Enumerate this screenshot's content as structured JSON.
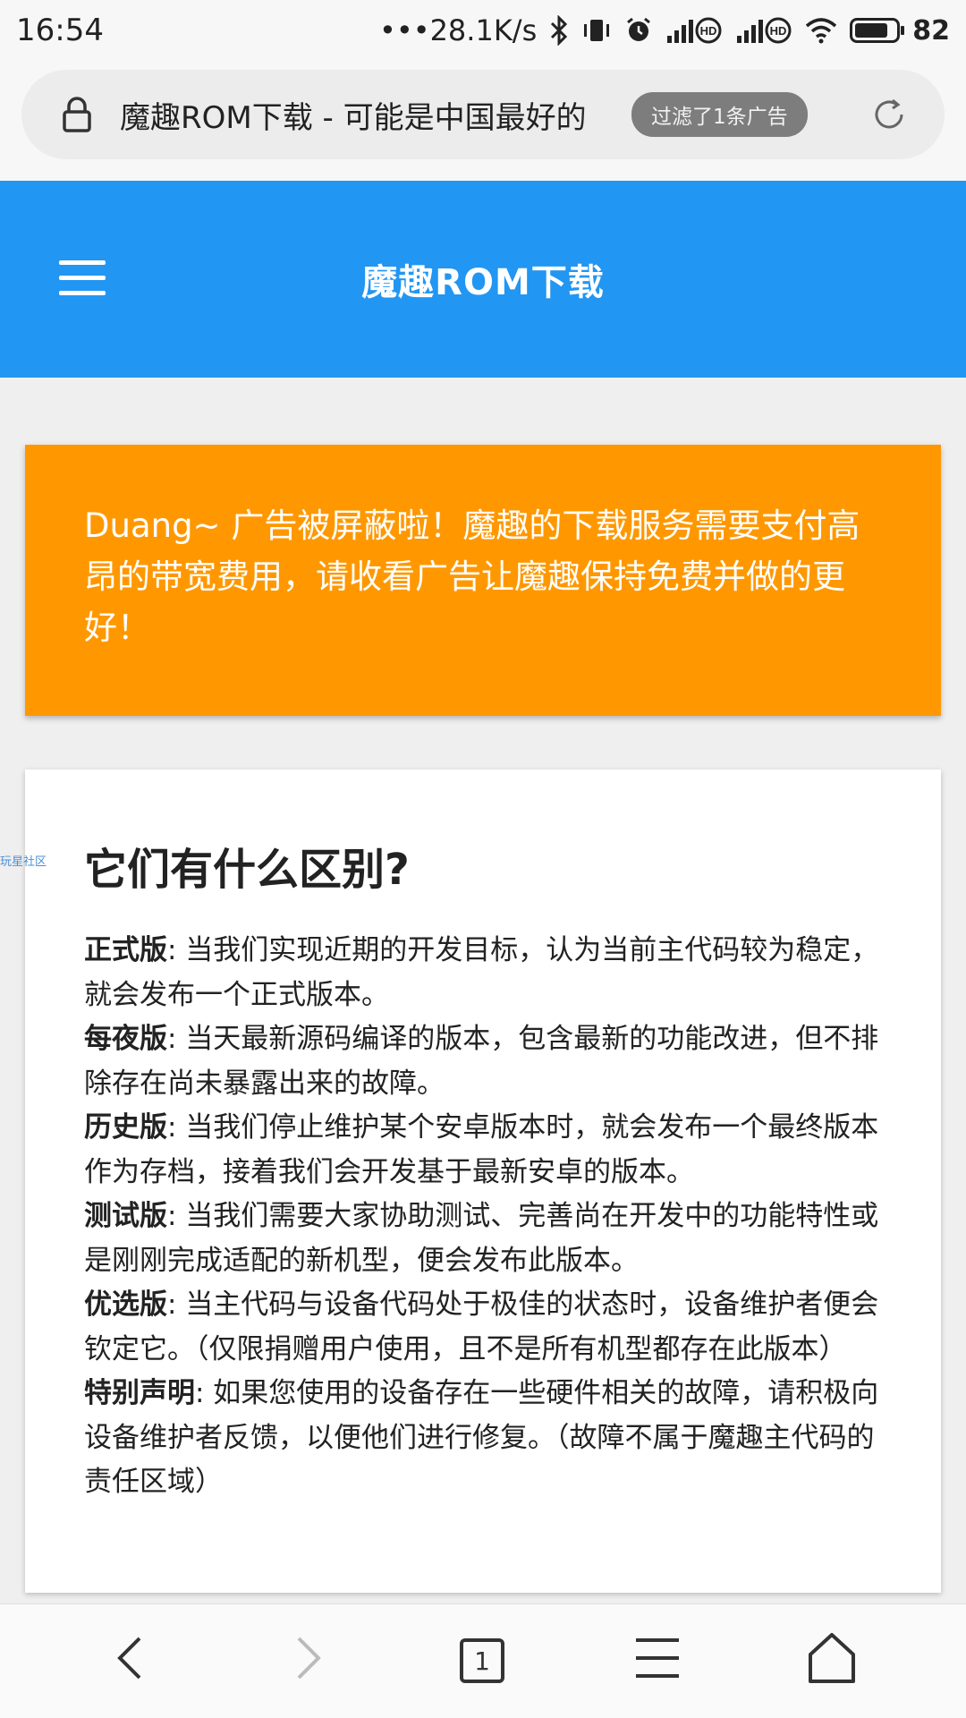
{
  "status_bar": {
    "time": "16:54",
    "net_speed": "•••28.1K/s",
    "battery": "82",
    "battery_level": 0.82
  },
  "address_bar": {
    "title": "魔趣ROM下载 - 可能是中国最好的",
    "ad_filter_badge": "过滤了1条广告"
  },
  "header": {
    "title": "魔趣ROM下载"
  },
  "notice": {
    "text": "Duang~ 广告被屏蔽啦！魔趣的下载服务需要支付高昂的带宽费用，请收看广告让魔趣保持免费并做的更好！"
  },
  "side_watermark": "玩星社区",
  "info": {
    "heading": "它们有什么区别?",
    "items": [
      {
        "term": "正式版",
        "desc": ": 当我们实现近期的开发目标，认为当前主代码较为稳定，就会发布一个正式版本。"
      },
      {
        "term": "每夜版",
        "desc": ": 当天最新源码编译的版本，包含最新的功能改进，但不排除存在尚未暴露出来的故障。"
      },
      {
        "term": "历史版",
        "desc": ": 当我们停止维护某个安卓版本时，就会发布一个最终版本作为存档，接着我们会开发基于最新安卓的版本。"
      },
      {
        "term": "测试版",
        "desc": ": 当我们需要大家协助测试、完善尚在开发中的功能特性或是刚刚完成适配的新机型，便会发布此版本。"
      },
      {
        "term": "优选版",
        "desc": ": 当主代码与设备代码处于极佳的状态时，设备维护者便会钦定它。（仅限捐赠用户使用，且不是所有机型都存在此版本）"
      },
      {
        "term": "特别声明",
        "desc": ": 如果您使用的设备存在一些硬件相关的故障，请积极向设备维护者反馈，以便他们进行修复。（故障不属于魔趣主代码的责任区域）"
      }
    ]
  },
  "bottom_nav": {
    "tab_count": "1",
    "icons": [
      "back-arrow-icon",
      "forward-arrow-icon",
      "tabs-icon",
      "menu-icon",
      "home-icon"
    ]
  }
}
